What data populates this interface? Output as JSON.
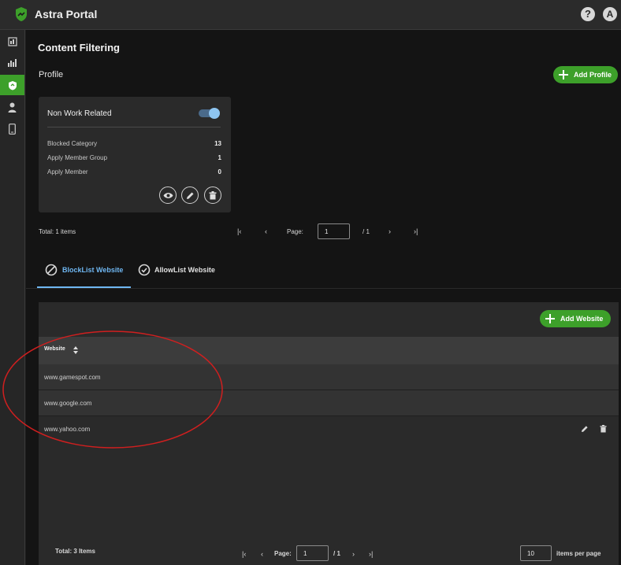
{
  "app": {
    "title": "Astra Portal",
    "help_icon": "question-icon",
    "user_initial": "A"
  },
  "colors": {
    "accent": "#3da02a",
    "tab_active": "#6fb7f2",
    "annotation": "#d01f1f"
  },
  "sidebar": {
    "items": [
      {
        "icon": "dashboard-icon",
        "active": false
      },
      {
        "icon": "bar-chart-icon",
        "active": false
      },
      {
        "icon": "shield-icon",
        "active": true
      },
      {
        "icon": "user-icon",
        "active": false
      },
      {
        "icon": "mobile-icon",
        "active": false
      }
    ]
  },
  "page": {
    "title": "Content Filtering",
    "profile_label": "Profile",
    "add_profile_label": "Add Profile"
  },
  "profile_card": {
    "name": "Non Work Related",
    "enabled": true,
    "stats": [
      {
        "label": "Blocked Category",
        "value": "13"
      },
      {
        "label": "Apply Member Group",
        "value": "1"
      },
      {
        "label": "Apply Member",
        "value": "0"
      }
    ],
    "actions": [
      "eye-icon",
      "pencil-icon",
      "trash-icon"
    ]
  },
  "profile_pager": {
    "total": "Total: 1 items",
    "page_label": "Page:",
    "page_value": "1",
    "page_count": "/ 1"
  },
  "tabs": [
    {
      "label": "BlockList Website",
      "icon": "block-icon",
      "active": true
    },
    {
      "label": "AllowList Website",
      "icon": "check-circle-icon",
      "active": false
    }
  ],
  "website_table": {
    "add_label": "Add Website",
    "column_header": "Website",
    "rows": [
      "www.gamespot.com",
      "www.google.com",
      "www.yahoo.com"
    ]
  },
  "website_pager": {
    "total": "Total: 3 Items",
    "page_label": "Page:",
    "page_value": "1",
    "page_count": "/ 1",
    "items_per_page_value": "10",
    "items_per_page_label": "items per page"
  }
}
